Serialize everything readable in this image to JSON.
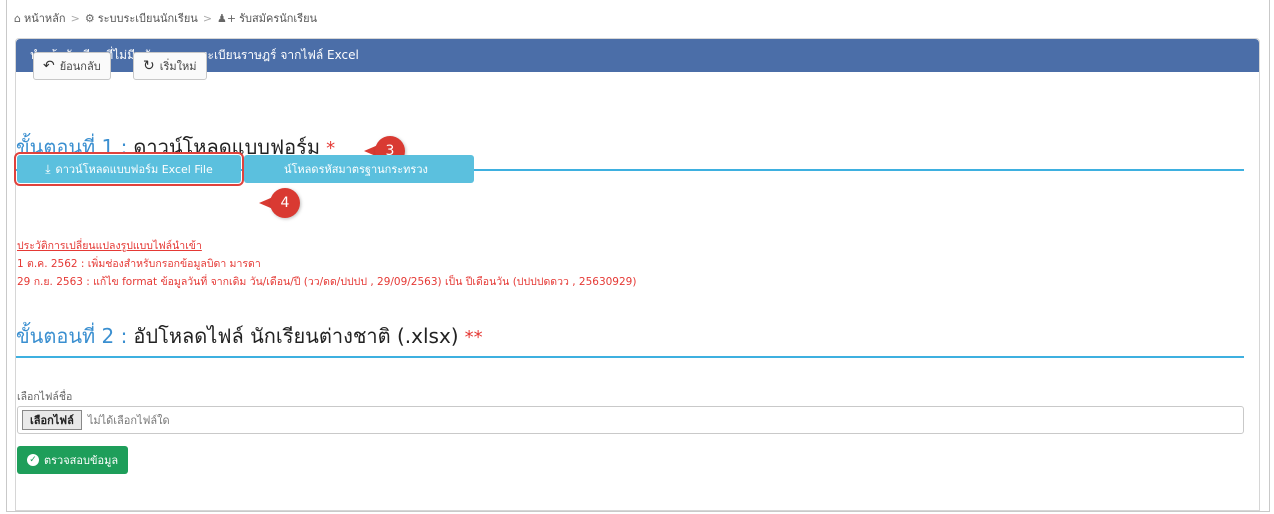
{
  "breadcrumb": {
    "home": "หน้าหลัก",
    "system": "ระบบระเบียนนักเรียน",
    "current": "รับสมัครนักเรียน"
  },
  "panel": {
    "title": "นำเข้านักเรียนที่ไม่มีหลักฐานทางทะเบียนราษฎร์ จากไฟล์ Excel"
  },
  "toolbar": {
    "back_label": "ย้อนกลับ",
    "reset_label": "เริ่มใหม่"
  },
  "step1": {
    "prefix": "ขั้นตอนที่ 1 :",
    "title": "ดาวน์โหลดแบบฟอร์ม",
    "marker": "*",
    "download_form_label": "ดาวน์โหลดแบบฟอร์ม Excel File",
    "download_codes_label": "น์โหลดรหัสมาตรฐานกระทรวง",
    "history_title": "ประวัติการเปลี่ยนแปลงรูปแบบไฟล์นำเข้า",
    "history": [
      "1 ต.ค. 2562 : เพิ่มช่องสำหรับกรอกข้อมูลบิดา มารดา",
      "29 ก.ย. 2563 : แก้ไข format ข้อมูลวันที่ จากเดิม วัน/เดือน/ปี (วว/ดด/ปปปป , 29/09/2563) เป็น ปีเดือนวัน (ปปปปดดวว , 25630929)"
    ]
  },
  "step2": {
    "prefix": "ขั้นตอนที่ 2 :",
    "title": "อัปโหลดไฟล์ นักเรียนต่างชาติ (.xlsx)",
    "marker": "**",
    "file_label": "เลือกไฟล์ชื่อ",
    "choose_file_label": "เลือกไฟล์",
    "no_file_text": "ไม่ได้เลือกไฟล์ใด",
    "check_label": "ตรวจสอบข้อมูล"
  },
  "callouts": {
    "one": "3",
    "two": "4"
  },
  "colors": {
    "panel_header": "#4b6ea8",
    "accent_blue": "#3a8fd0",
    "info_button": "#5bc0de",
    "success_button": "#1e9e5a",
    "warning_text": "#e53935",
    "callout": "#d93a32"
  }
}
